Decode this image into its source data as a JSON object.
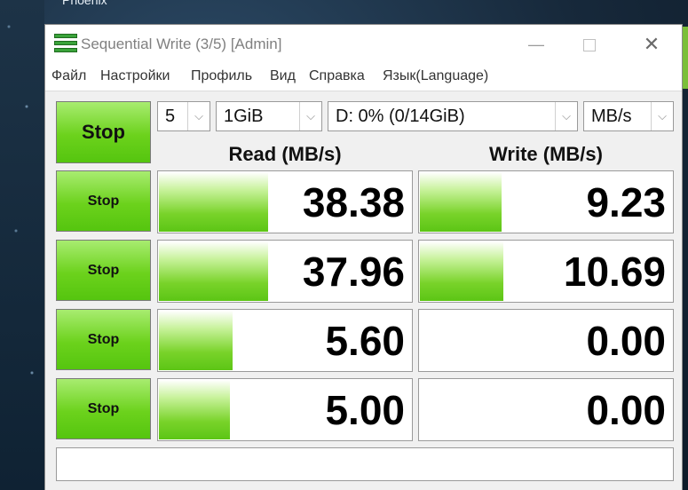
{
  "desktop": {
    "label": "Phoenix"
  },
  "window": {
    "title": "Sequential Write (3/5) [Admin]",
    "controls": {
      "minimize": "—",
      "close": "✕"
    }
  },
  "menu": [
    "Файл",
    "Настройки",
    "Профиль",
    "Вид",
    "Справка",
    "Язык(Language)"
  ],
  "toolbar": {
    "main_button": "Stop",
    "count": "5",
    "size": "1GiB",
    "drive": "D: 0% (0/14GiB)",
    "unit": "MB/s",
    "dropdown_arrow": "⌵"
  },
  "headers": {
    "read": "Read (MB/s)",
    "write": "Write (MB/s)"
  },
  "rows": [
    {
      "button": "Stop",
      "read": "38.38",
      "write": "9.23",
      "read_fill": 0.43,
      "write_fill": 0.32
    },
    {
      "button": "Stop",
      "read": "37.96",
      "write": "10.69",
      "read_fill": 0.43,
      "write_fill": 0.33
    },
    {
      "button": "Stop",
      "read": "5.60",
      "write": "0.00",
      "read_fill": 0.29,
      "write_fill": 0.0
    },
    {
      "button": "Stop",
      "read": "5.00",
      "write": "0.00",
      "read_fill": 0.28,
      "write_fill": 0.0
    }
  ],
  "status_text": ""
}
